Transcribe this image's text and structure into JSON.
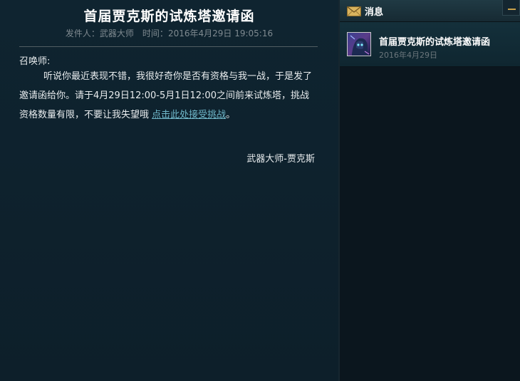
{
  "message": {
    "title": "首届贾克斯的试炼塔邀请函",
    "sender_label": "发件人：",
    "sender": "武器大师",
    "time_label": "时间：",
    "time": "2016年4月29日 19:05:16",
    "greeting": "召唤师:",
    "body_text": "听说你最近表现不错，我很好奇你是否有资格与我一战，于是发了邀请函给你。请于4月29日12:00-5月1日12:00之间前来试炼塔，挑战资格数量有限，不要让我失望哦 ",
    "link_text": "点击此处接受挑战",
    "body_end": "。",
    "signature": "武器大师-贾克斯"
  },
  "inbox": {
    "title": "消息",
    "mail_icon": "envelope-icon",
    "minimize_icon": "minimize-icon",
    "accent_color": "#c9a24a",
    "items": [
      {
        "title": "首届贾克斯的试炼塔邀请函",
        "date": "2016年4月29日",
        "avatar_icon": "jax-champion-avatar"
      }
    ]
  }
}
